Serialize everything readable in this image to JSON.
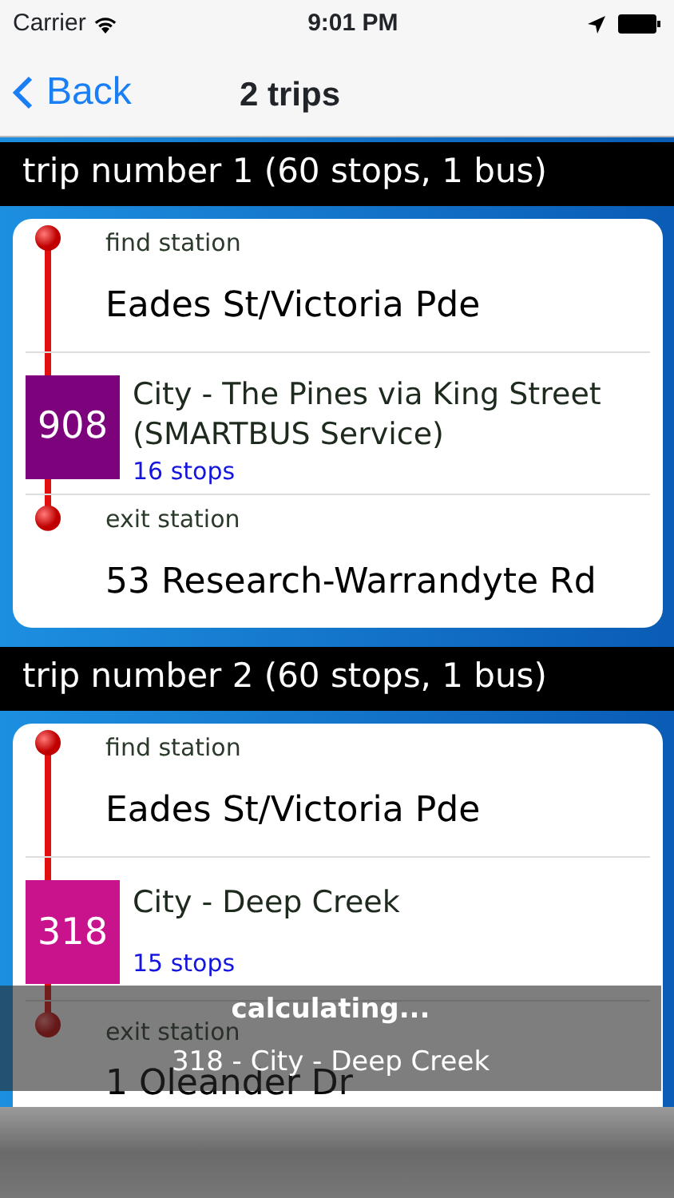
{
  "status_bar": {
    "carrier": "Carrier",
    "time": "9:01 PM"
  },
  "nav": {
    "back": "Back",
    "title": "2 trips"
  },
  "trips": [
    {
      "header": "trip number 1 (60 stops, 1 bus)",
      "origin_label": "find station",
      "origin": "Eades St/Victoria Pde",
      "route": {
        "number": "908",
        "color": "#7d037d",
        "name": "City - The Pines via King Street (SMARTBUS Service)",
        "stops": "16 stops"
      },
      "exit_label": "exit station",
      "exit": "53 Research-Warrandyte Rd"
    },
    {
      "header": "trip number 2 (60 stops, 1 bus)",
      "origin_label": "find station",
      "origin": "Eades St/Victoria Pde",
      "route": {
        "number": "318",
        "color": "#c8138c",
        "name": "City - Deep Creek",
        "stops": "15 stops"
      },
      "exit_label": "exit station",
      "exit": "1 Oleander Dr"
    }
  ],
  "overlay": {
    "title": "calculating...",
    "subtitle": "318 - City - Deep Creek"
  }
}
